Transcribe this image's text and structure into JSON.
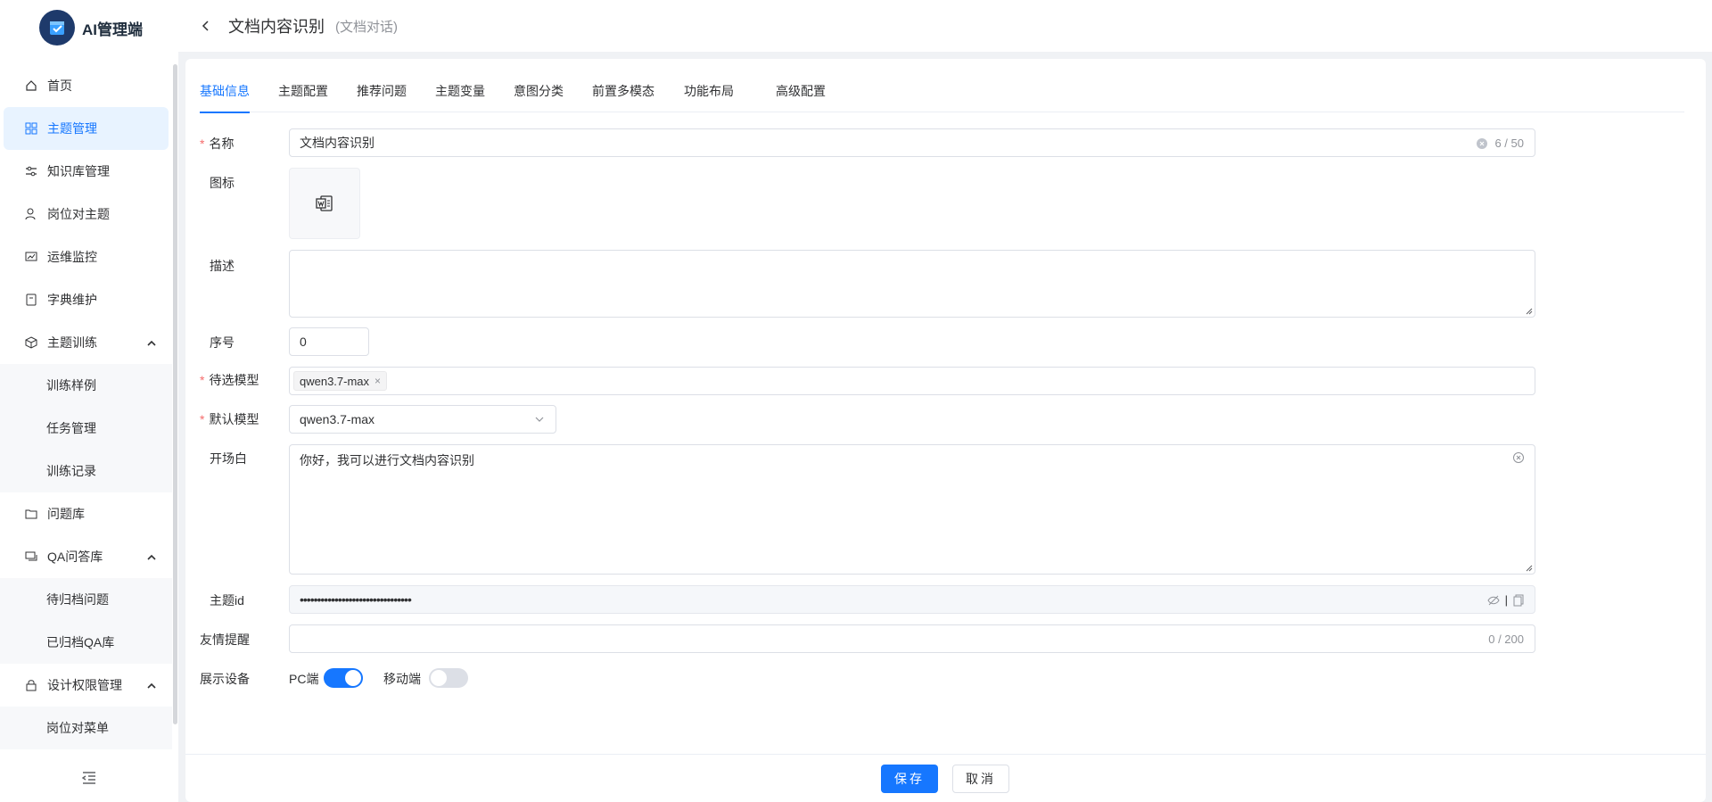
{
  "app": {
    "name": "AI管理端"
  },
  "sidebar": {
    "items": [
      {
        "label": "首页",
        "icon": "home-icon"
      },
      {
        "label": "主题管理",
        "icon": "grid-icon",
        "active": true
      },
      {
        "label": "知识库管理",
        "icon": "sliders-icon"
      },
      {
        "label": "岗位对主题",
        "icon": "user-settings-icon"
      },
      {
        "label": "运维监控",
        "icon": "monitor-chart-icon"
      },
      {
        "label": "字典维护",
        "icon": "book-icon"
      },
      {
        "label": "主题训练",
        "icon": "cube-icon",
        "expanded": true
      },
      {
        "label": "问题库",
        "icon": "folder-icon"
      },
      {
        "label": "QA问答库",
        "icon": "chat-icon",
        "expanded": true
      },
      {
        "label": "设计权限管理",
        "icon": "lock-icon",
        "expanded": true
      }
    ],
    "training_sub": [
      "训练样例",
      "任务管理",
      "训练记录"
    ],
    "qa_sub": [
      "待归档问题",
      "已归档QA库"
    ],
    "perm_sub": [
      "岗位对菜单"
    ]
  },
  "header": {
    "title": "文档内容识别",
    "subtitle": "(文档对话)"
  },
  "tabs": [
    "基础信息",
    "主题配置",
    "推荐问题",
    "主题变量",
    "意图分类",
    "前置多模态",
    "功能布局",
    "高级配置"
  ],
  "form": {
    "name_label": "名称",
    "name_value": "文档内容识别",
    "name_count": "6 / 50",
    "icon_label": "图标",
    "desc_label": "描述",
    "desc_value": "",
    "order_label": "序号",
    "order_value": "0",
    "candidate_label": "待选模型",
    "candidate_tag": "qwen3.7-max",
    "default_label": "默认模型",
    "default_value": "qwen3.7-max",
    "opening_label": "开场白",
    "opening_value": "你好，我可以进行文档内容识别",
    "id_label": "主题id",
    "id_value": "••••••••••••••••••••••••••••••••",
    "tip_label": "友情提醒",
    "tip_count": "0 / 200",
    "device_label": "展示设备",
    "pc_label": "PC端",
    "pc_on": true,
    "mobile_label": "移动端",
    "mobile_on": false
  },
  "footer": {
    "save": "保存",
    "cancel": "取消"
  },
  "colors": {
    "primary": "#1677ff",
    "required": "#f56c6c"
  }
}
